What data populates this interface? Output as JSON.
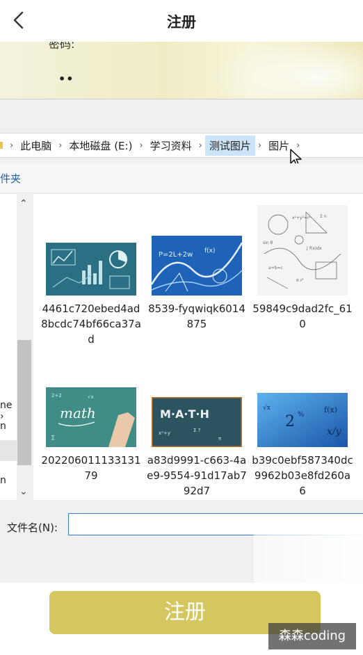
{
  "header": {
    "title": "注册"
  },
  "background": {
    "label_partial": "密码:",
    "password_dots": "••"
  },
  "dialog": {
    "breadcrumb": [
      "此电脑",
      "本地磁盘 (E:)",
      "学习资料",
      "测试图片",
      "图片"
    ],
    "toolbar_label": "件夹",
    "nav_items": [
      "ne ›",
      "n",
      "n"
    ],
    "files": [
      {
        "name": "4461c720ebed4ad8bcdc74bf66ca37ad"
      },
      {
        "name": "8539-fyqwiqk6014875"
      },
      {
        "name": "59849c9dad2fc_610"
      },
      {
        "name": "20220601113313179"
      },
      {
        "name": "a83d9991-c663-4ae9-9554-91d17ab792d7"
      },
      {
        "name": "b39c0ebf587340dc9962b03e8fd260a6"
      }
    ],
    "filename_label": "文件名(N):",
    "filename_value": ""
  },
  "register_button": "注册",
  "watermark": "森森coding",
  "colors": {
    "accent": "#d5c760",
    "selection": "#cce4f7",
    "input_border": "#2e7fd6"
  }
}
